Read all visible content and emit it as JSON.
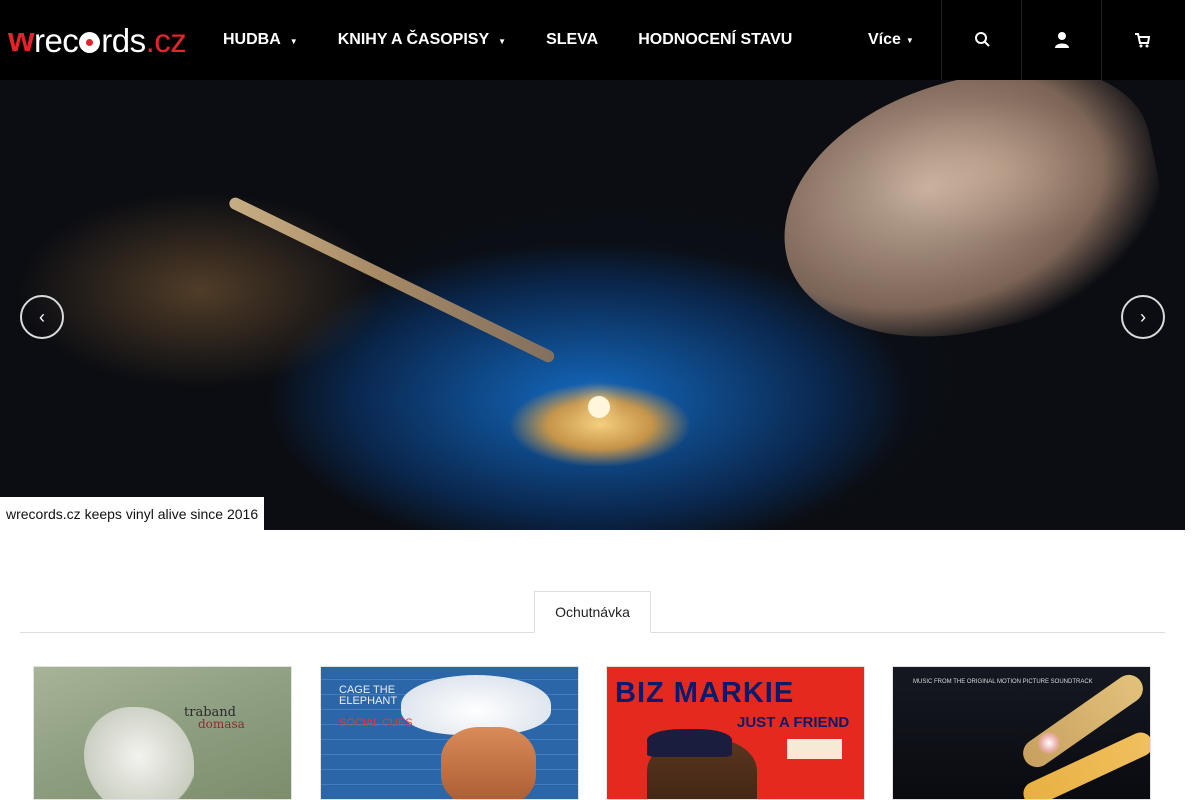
{
  "brand": {
    "logo_w": "w",
    "logo_rec": "rec",
    "logo_rds": "rds",
    "logo_cz": ".cz"
  },
  "nav": {
    "items": [
      {
        "label": "HUDBA",
        "has_dropdown": true
      },
      {
        "label": "KNIHY A ČASOPISY",
        "has_dropdown": true
      },
      {
        "label": "SLEVA",
        "has_dropdown": false
      },
      {
        "label": "HODNOCENÍ STAVU",
        "has_dropdown": false
      }
    ],
    "more_label": "Více",
    "icon_buttons": [
      "search-icon",
      "user-icon",
      "cart-icon"
    ]
  },
  "hero": {
    "caption": "wrecords.cz keeps vinyl alive since 2016",
    "prev_icon": "chevron-left-icon",
    "next_icon": "chevron-right-icon"
  },
  "tabs": {
    "active_label": "Ochutnávka"
  },
  "products": [
    {
      "cover_text_1": "traband",
      "cover_text_2": "domasa"
    },
    {
      "cover_text_1": "CAGE THE ELEPHANT",
      "cover_text_2": "SOCIAL CUES"
    },
    {
      "cover_text_1": "BIZ MARKIE",
      "cover_text_2": "JUST A FRIEND"
    },
    {
      "cover_text_1": "MUSIC FROM THE ORIGINAL MOTION PICTURE SOUNDTRACK"
    }
  ],
  "colors": {
    "header_bg": "#000000",
    "accent": "#e3242b",
    "tab_border": "#dddddd"
  }
}
